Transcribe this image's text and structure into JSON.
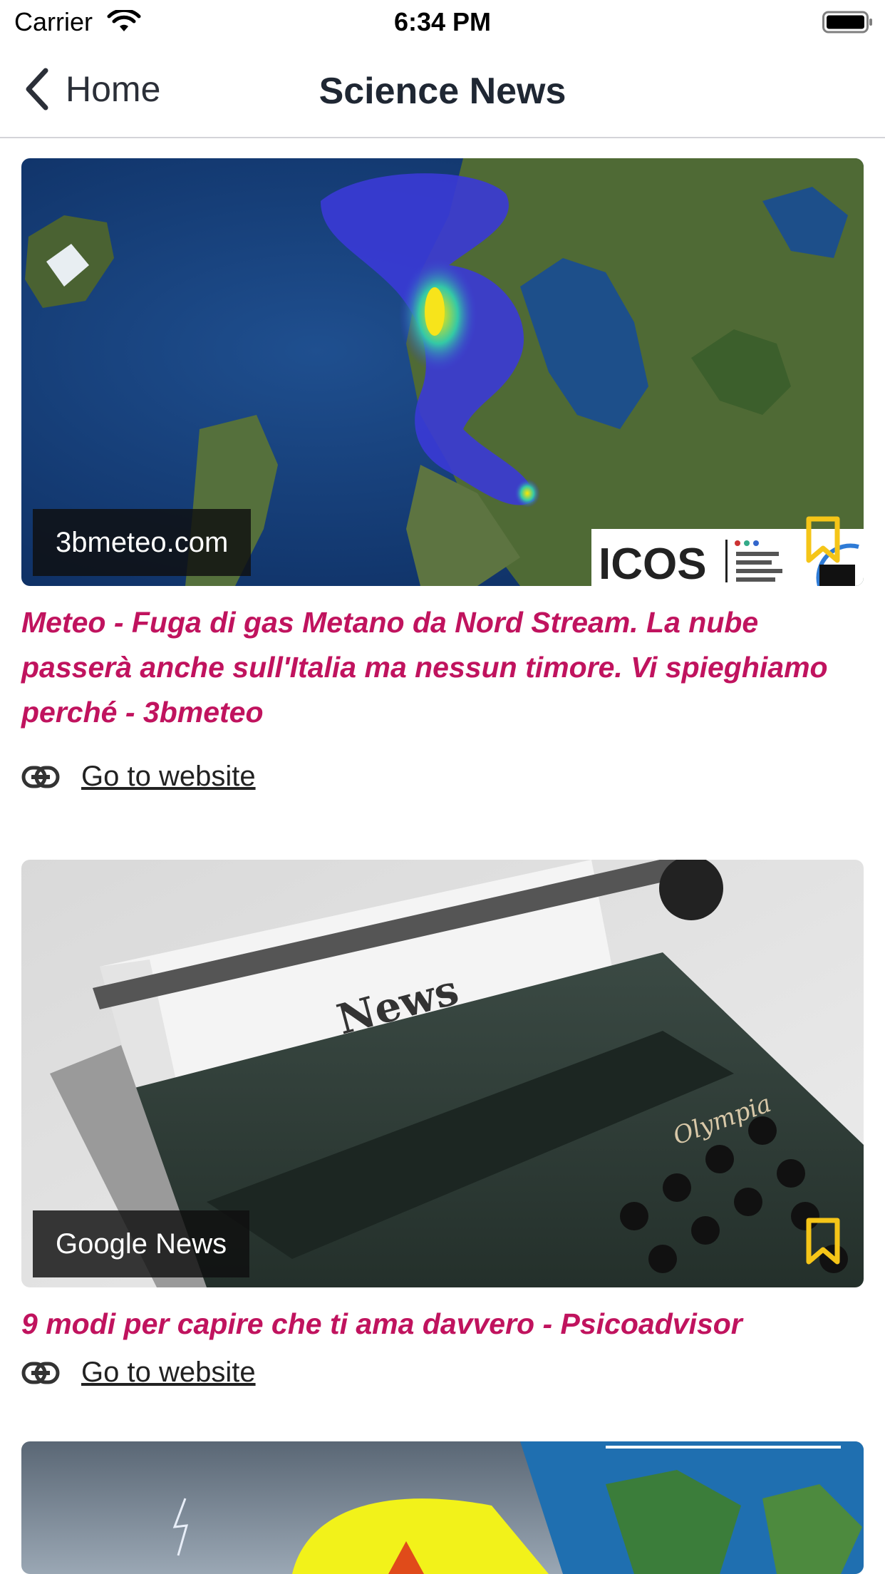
{
  "status_bar": {
    "carrier": "Carrier",
    "time": "6:34 PM"
  },
  "nav": {
    "back_label": "Home",
    "title": "Science News"
  },
  "articles": [
    {
      "source": "3bmeteo.com",
      "image_text": "ICOS",
      "title": "Meteo - Fuga di gas Metano da Nord Stream. La nube passerà anche sull'Italia ma nessun timore. Vi spieghiamo perché - 3bmeteo",
      "link_label": "Go to website"
    },
    {
      "source": "Google News",
      "image_text": "News",
      "image_text_2": "Olympia",
      "title": "9 modi per capire che ti ama davvero - Psicoadvisor",
      "link_label": "Go to website"
    }
  ],
  "colors": {
    "title_accent": "#c0135e",
    "bookmark": "#f5c518"
  },
  "icons": [
    "back-chevron-icon",
    "wifi-icon",
    "battery-icon",
    "bookmark-icon",
    "link-icon"
  ]
}
